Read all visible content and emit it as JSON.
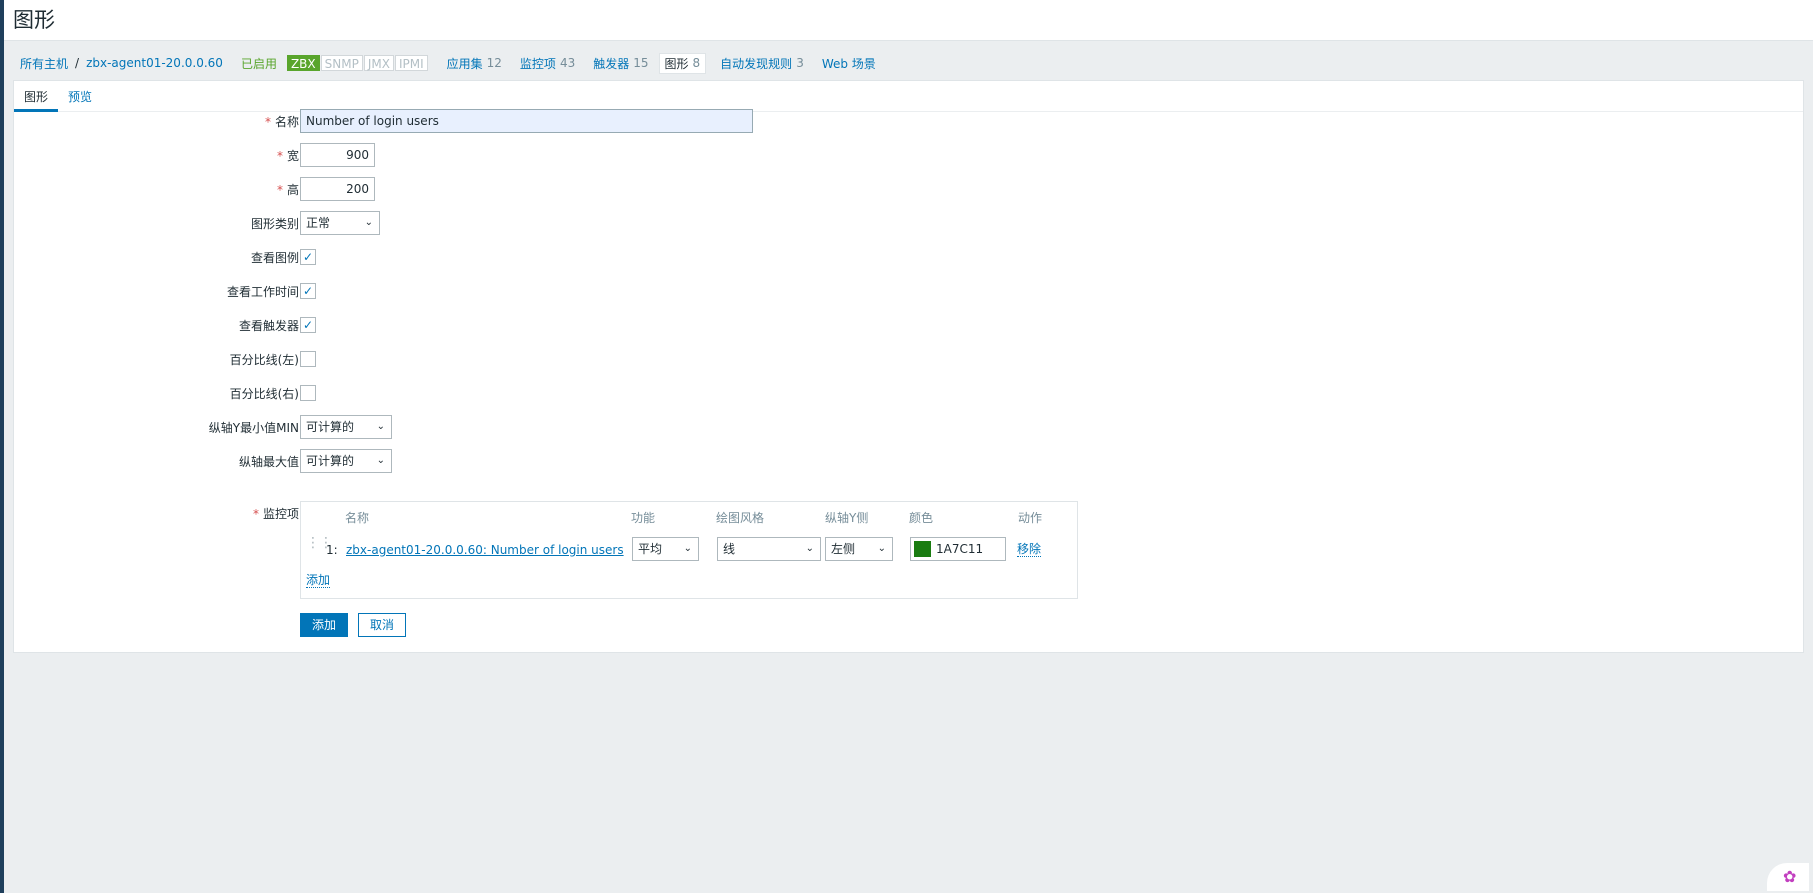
{
  "page": {
    "title": "图形"
  },
  "nav": {
    "all_hosts": "所有主机",
    "separator": "/",
    "host": "zbx-agent01-20.0.0.60",
    "status": "已启用",
    "badges": [
      {
        "label": "ZBX",
        "active": true
      },
      {
        "label": "SNMP",
        "active": false
      },
      {
        "label": "JMX",
        "active": false
      },
      {
        "label": "IPMI",
        "active": false
      }
    ],
    "items": [
      {
        "label": "应用集",
        "count": "12"
      },
      {
        "label": "监控项",
        "count": "43"
      },
      {
        "label": "触发器",
        "count": "15"
      },
      {
        "label": "图形",
        "count": "8"
      },
      {
        "label": "自动发现规则",
        "count": "3"
      },
      {
        "label": "Web 场景",
        "count": ""
      }
    ]
  },
  "tabs": {
    "graph": "图形",
    "preview": "预览"
  },
  "form": {
    "required_mark": "*",
    "name_label": "名称",
    "name_value": "Number of login users",
    "width_label": "宽",
    "width_value": "900",
    "height_label": "高",
    "height_value": "200",
    "graph_type_label": "图形类别",
    "graph_type_value": "正常",
    "show_legend_label": "查看图例",
    "show_legend": true,
    "show_work_period_label": "查看工作时间",
    "show_work_period": true,
    "show_triggers_label": "查看触发器",
    "show_triggers": true,
    "percentile_left_label": "百分比线(左)",
    "percentile_left": false,
    "percentile_right_label": "百分比线(右)",
    "percentile_right": false,
    "ymin_label": "纵轴Y最小值MIN",
    "ymin_value": "可计算的",
    "ymax_label": "纵轴最大值",
    "ymax_value": "可计算的",
    "items_label": "监控项"
  },
  "items_table": {
    "headers": {
      "name": "名称",
      "function": "功能",
      "draw_style": "绘图风格",
      "y_axis": "纵轴Y侧",
      "color": "颜色",
      "action": "动作"
    },
    "rows": [
      {
        "index": "1:",
        "name": "zbx-agent01-20.0.0.60: Number of login users",
        "function": "平均",
        "draw_style": "线",
        "y_axis": "左侧",
        "color": "1A7C11",
        "color_hex": "#1A7C11",
        "action": "移除"
      }
    ],
    "add_link": "添加"
  },
  "buttons": {
    "add": "添加",
    "cancel": "取消"
  },
  "icons": {
    "chevron": "chevron-down-icon",
    "check": "check-icon",
    "drag": "drag-handle-icon"
  }
}
